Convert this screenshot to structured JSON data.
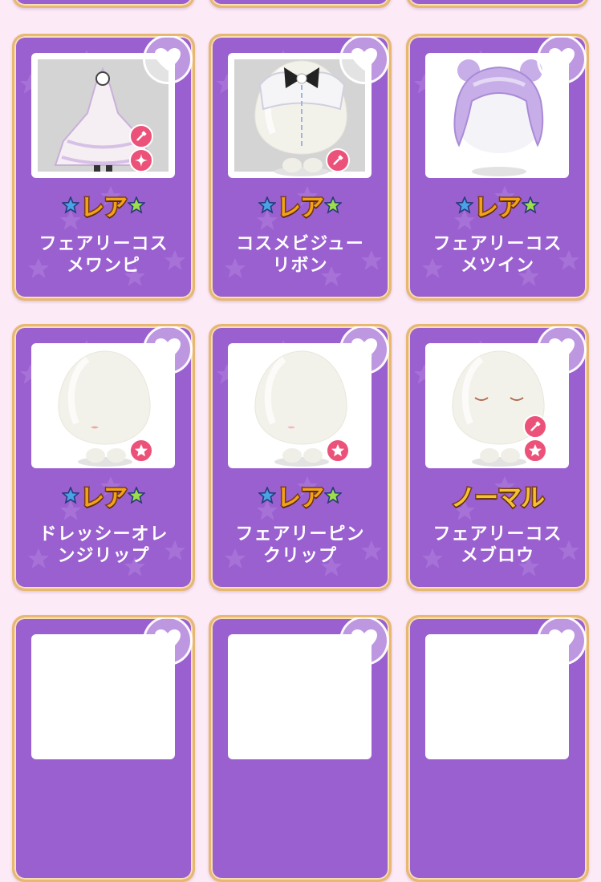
{
  "colors": {
    "page_bg": "#fcebf6",
    "card_bg": "#9a60d0",
    "card_border": "#e8b873",
    "badge_pink": "#ec5279"
  },
  "items": [
    {
      "rarity": "レア",
      "name_line1": "フェアリーコス",
      "name_line2": "メワンピ",
      "thumb": "dress",
      "badges": [
        "dropper-icon",
        "sparkle-icon"
      ]
    },
    {
      "rarity": "レア",
      "name_line1": "コスメビジュー",
      "name_line2": "リボン",
      "thumb": "ribbon",
      "badges": [
        "dropper-icon"
      ]
    },
    {
      "rarity": "レア",
      "name_line1": "フェアリーコス",
      "name_line2": "メツイン",
      "thumb": "hair",
      "badges": []
    },
    {
      "rarity": "レア",
      "name_line1": "ドレッシーオレ",
      "name_line2": "ンジリップ",
      "thumb": "lip",
      "badges": [
        "star-icon"
      ]
    },
    {
      "rarity": "レア",
      "name_line1": "フェアリーピン",
      "name_line2": "クリップ",
      "thumb": "lip2",
      "badges": [
        "star-icon"
      ]
    },
    {
      "rarity": "ノーマル",
      "name_line1": "フェアリーコス",
      "name_line2": "メブロウ",
      "thumb": "brow",
      "badges": [
        "dropper-icon",
        "star-icon"
      ]
    }
  ]
}
